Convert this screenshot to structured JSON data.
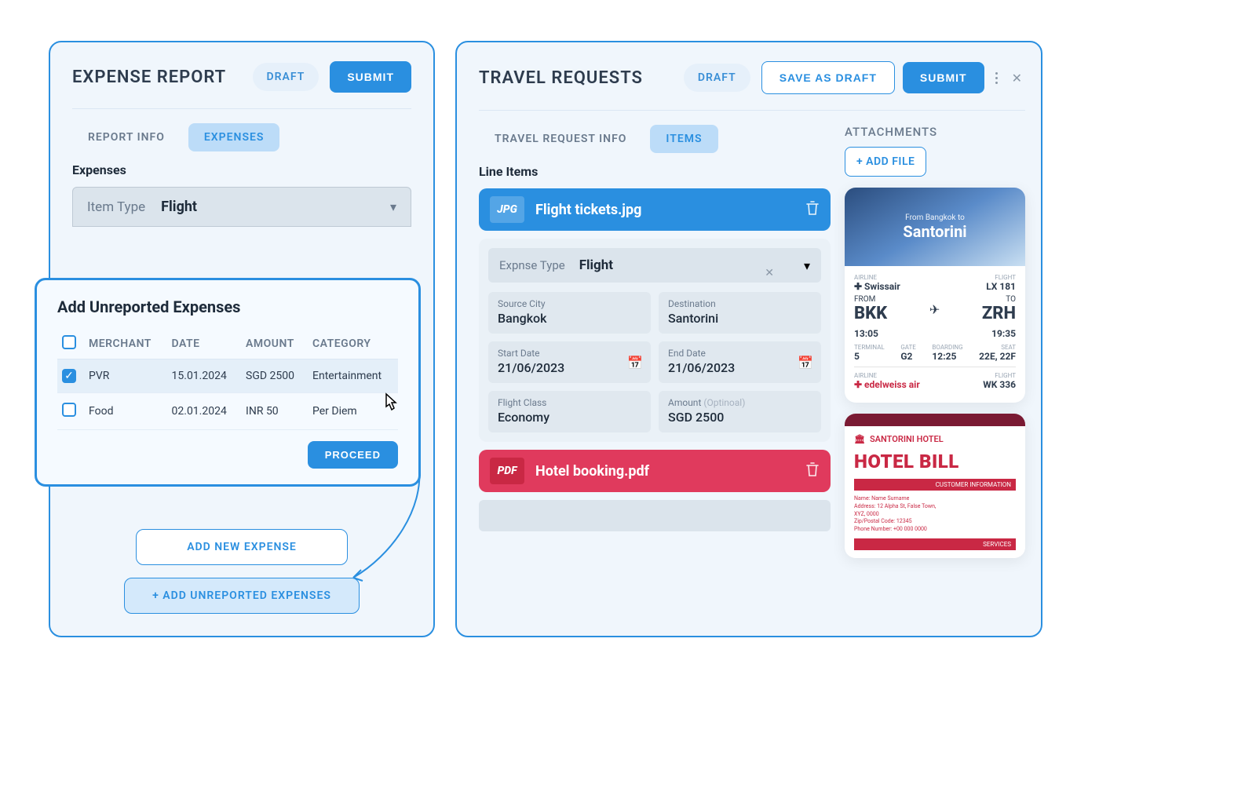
{
  "left": {
    "title": "EXPENSE REPORT",
    "draft": "DRAFT",
    "submit": "SUBMIT",
    "tabs": {
      "info": "REPORT INFO",
      "expenses": "EXPENSES"
    },
    "section": "Expenses",
    "item_type_label": "Item Type",
    "item_type_value": "Flight",
    "buttons": {
      "add_new": "ADD NEW EXPENSE",
      "add_unreported": "+ ADD UNREPORTED EXPENSES"
    }
  },
  "modal": {
    "title": "Add Unreported Expenses",
    "headers": {
      "merchant": "MERCHANT",
      "date": "DATE",
      "amount": "AMOUNT",
      "category": "CATEGORY"
    },
    "rows": [
      {
        "checked": true,
        "merchant": "PVR",
        "date": "15.01.2024",
        "amount": "SGD 2500",
        "category": "Entertainment"
      },
      {
        "checked": false,
        "merchant": "Food",
        "date": "02.01.2024",
        "amount": "INR 50",
        "category": "Per Diem"
      }
    ],
    "proceed": "PROCEED"
  },
  "right": {
    "title": "TRAVEL REQUESTS",
    "draft": "DRAFT",
    "save_draft": "SAVE AS DRAFT",
    "submit": "SUBMIT",
    "tabs": {
      "info": "TRAVEL REQUEST INFO",
      "items": "ITEMS"
    },
    "line_items": "Line Items",
    "file1": {
      "badge": "JPG",
      "name": "Flight tickets.jpg"
    },
    "expense_type_label": "Expnse Type",
    "expense_type_value": "Flight",
    "fields": {
      "source_label": "Source City",
      "source_value": "Bangkok",
      "dest_label": "Destination",
      "dest_value": "Santorini",
      "start_label": "Start Date",
      "start_value": "21/06/2023",
      "end_label": "End Date",
      "end_value": "21/06/2023",
      "class_label": "Flight Class",
      "class_value": "Economy",
      "amount_label": "Amount",
      "amount_opt": "(Optinoal)",
      "amount_value": "SGD 2500"
    },
    "file2": {
      "badge": "PDF",
      "name": "Hotel booking.pdf"
    },
    "attachments": {
      "title": "ATTACHMENTS",
      "add_file": "+ ADD FILE",
      "ticket": {
        "hero_small": "From Bangkok to",
        "hero_big": "Santorini",
        "airline1_label": "AIRLINE",
        "airline1": "Swissair",
        "flight1_label": "FLIGHT",
        "flight1": "LX 181",
        "from": "BKK",
        "to": "ZRH",
        "time_from": "13:05",
        "time_to": "19:35",
        "terminal_l": "TERMINAL",
        "terminal": "5",
        "gate_l": "GATE",
        "gate": "G2",
        "boarding_l": "BOARDING",
        "boarding": "12:25",
        "seat_l": "SEAT",
        "seat": "22E, 22F",
        "airline2_label": "AIRLINE",
        "airline2": "edelweiss air",
        "flight2_label": "FLIGHT",
        "flight2": "WK 336",
        "from_l": "FROM",
        "to_l": "TO"
      },
      "hotel": {
        "name": "SANTORINI HOTEL",
        "title": "HOTEL BILL",
        "band1": "CUSTOMER INFORMATION",
        "info": "Name: Name Surname\nAddress: 12 Alpha St, False Town,\nXYZ, 0000\nZip/Postal Code: 12345\nPhone Number: +00 000 0000",
        "band2": "SERVICES"
      }
    }
  }
}
